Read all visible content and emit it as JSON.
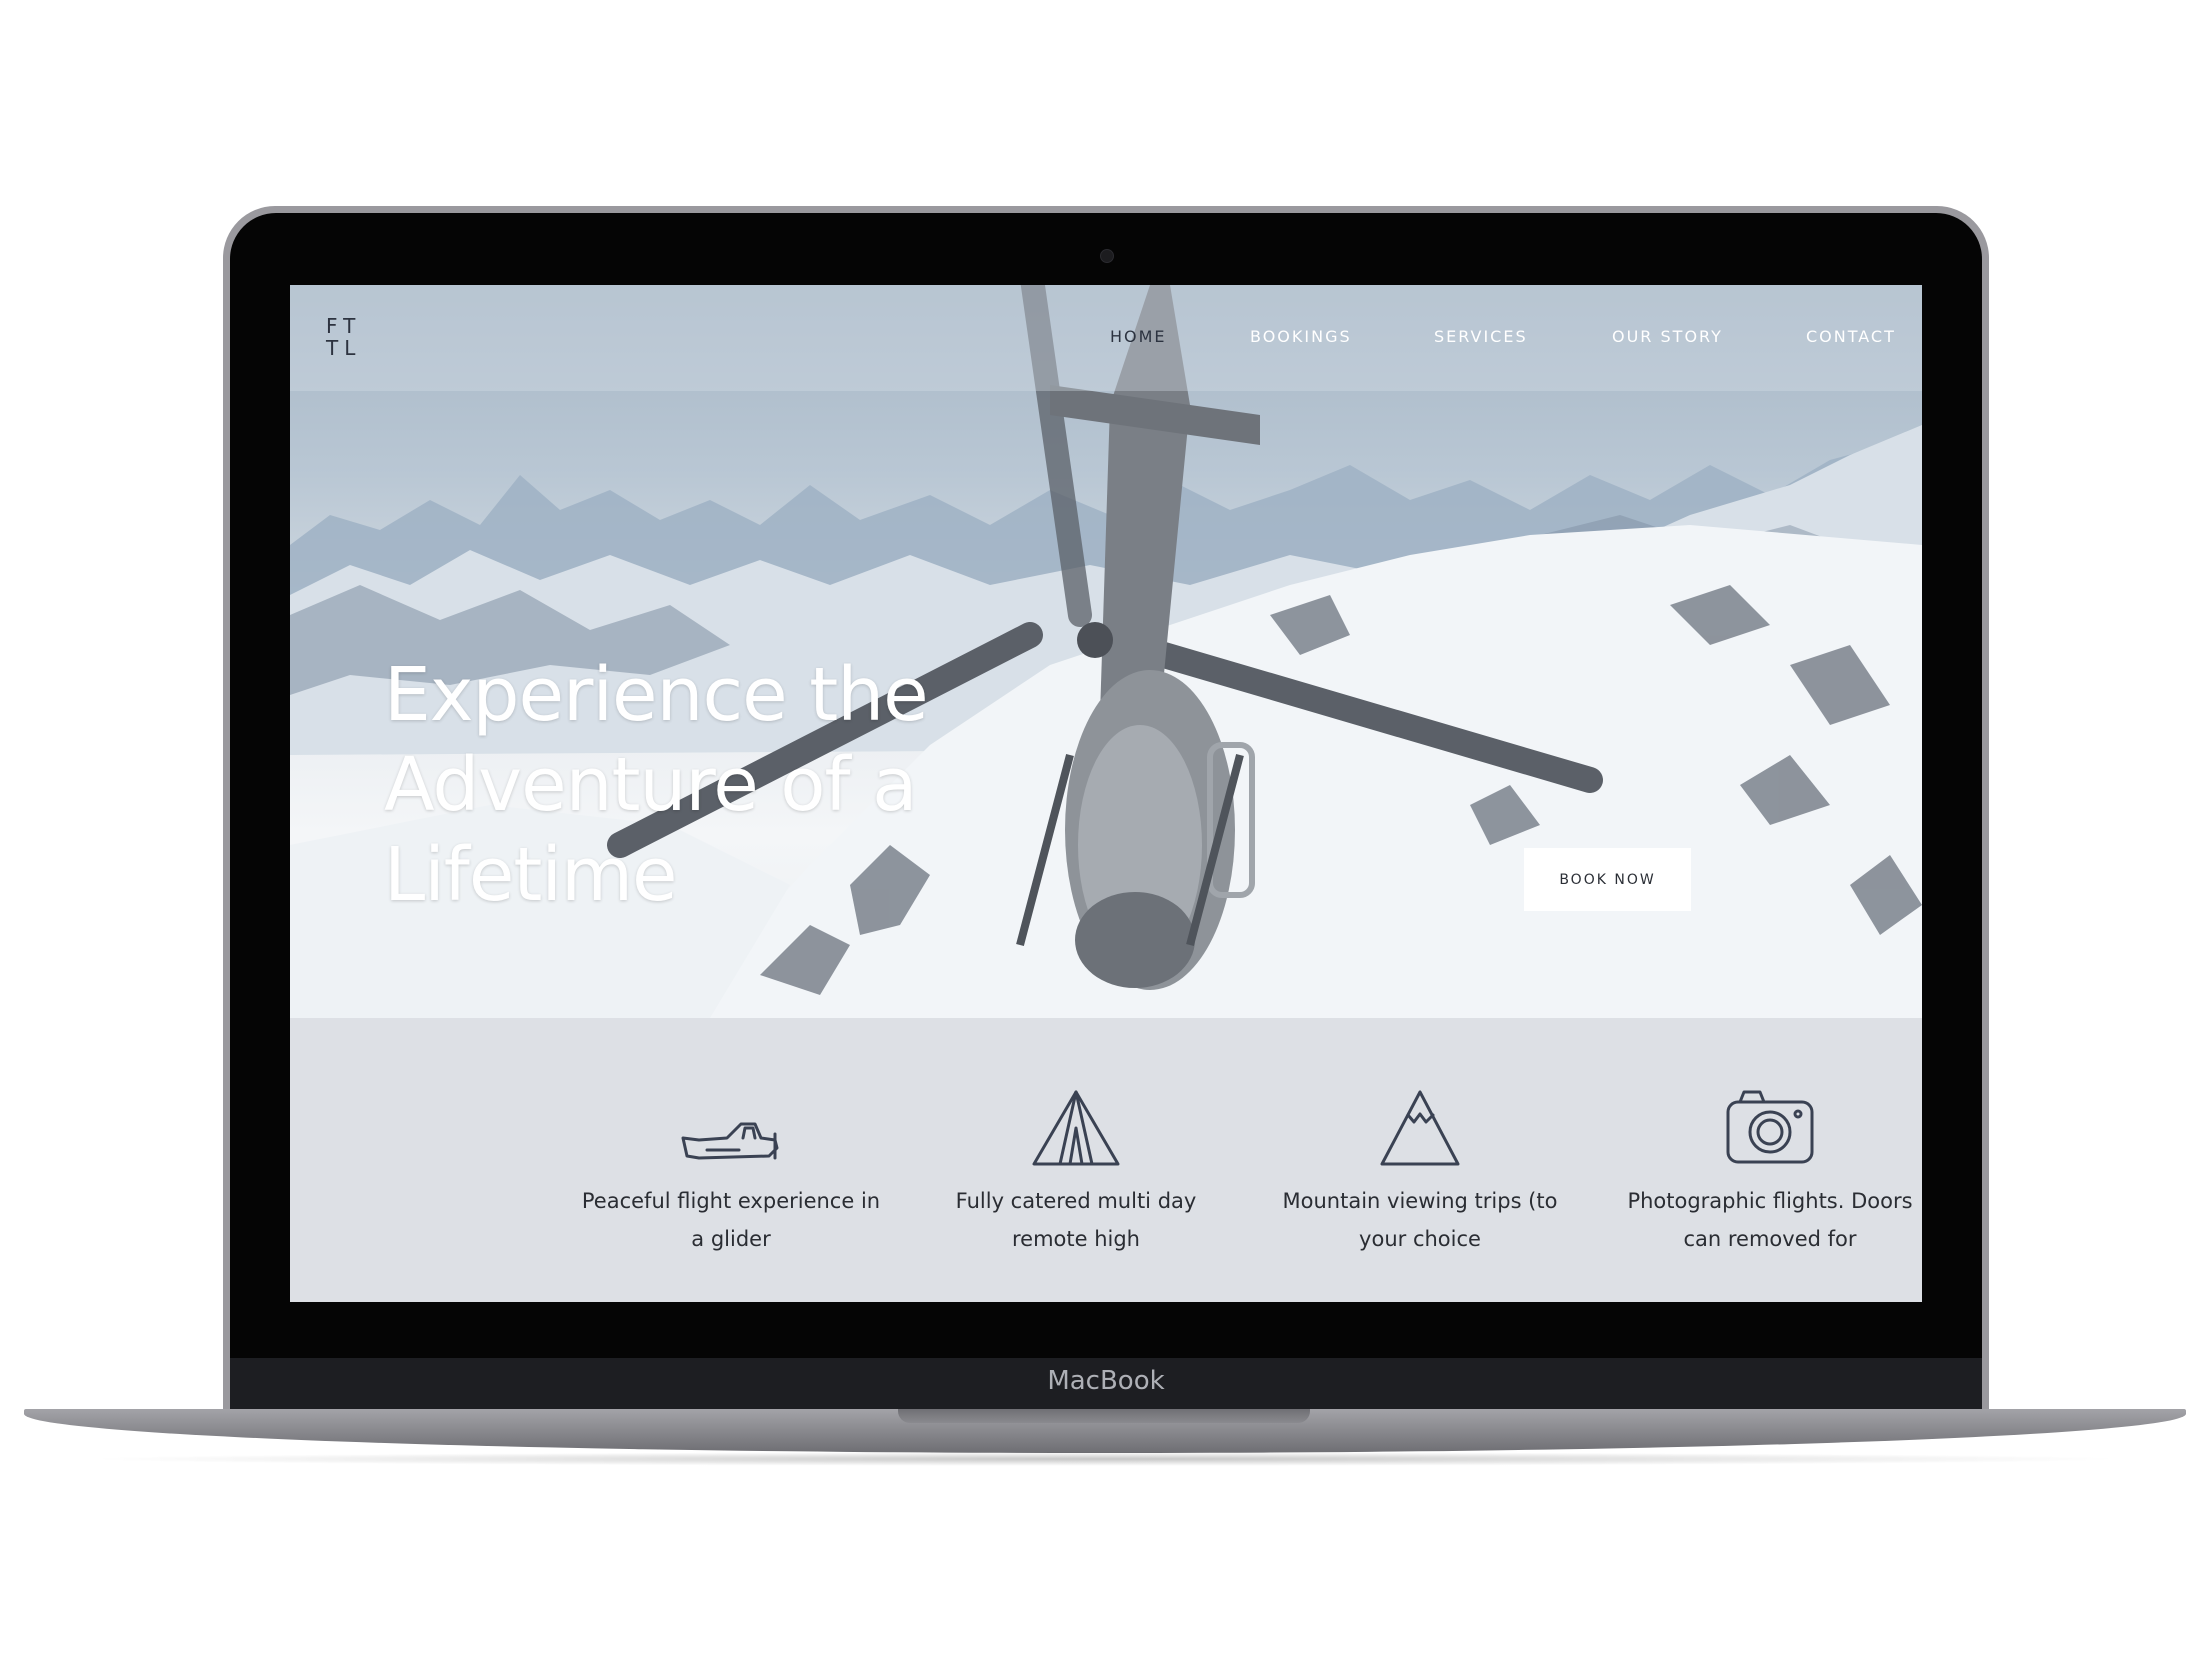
{
  "device": {
    "brand": "MacBook"
  },
  "site": {
    "logo": "FT TL",
    "nav": [
      {
        "label": "HOME"
      },
      {
        "label": "BOOKINGS"
      },
      {
        "label": "SERVICES"
      },
      {
        "label": "OUR STORY"
      },
      {
        "label": "CONTACT"
      }
    ],
    "hero": {
      "headline": "Experience the Adventure of a Lifetime",
      "cta": "BOOK NOW"
    },
    "features": [
      {
        "icon": "glider-plane-icon",
        "text": "Peaceful flight experience in a glider"
      },
      {
        "icon": "tent-icon",
        "text": "Fully catered multi day remote high"
      },
      {
        "icon": "mountain-icon",
        "text": "Mountain viewing trips (to your choice"
      },
      {
        "icon": "camera-icon",
        "text": "Photographic flights. Doors can removed for"
      }
    ]
  },
  "colors": {
    "nav_active": "#2c3340",
    "nav_text": "#ffffff",
    "feature_bg": "#dde0e5",
    "icon_stroke": "#3a4253",
    "button_bg": "#ffffff"
  }
}
